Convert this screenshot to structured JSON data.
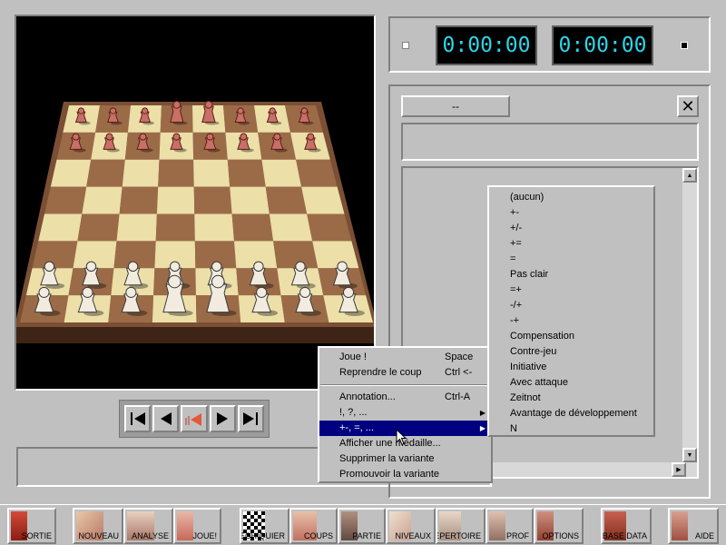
{
  "clocks": {
    "white_time": "0:00:00",
    "black_time": "0:00:00"
  },
  "analysis": {
    "variation_tab": "--",
    "close_glyph": "✕"
  },
  "context_menu": {
    "items": [
      {
        "label": "Joue !",
        "shortcut": "Space"
      },
      {
        "label": "Reprendre le coup",
        "shortcut": "Ctrl <-"
      },
      {
        "label": "Annotation...",
        "shortcut": "Ctrl-A"
      },
      {
        "label": "!, ?, ...",
        "submenu": true
      },
      {
        "label": "+-, =, ...",
        "submenu": true,
        "selected": true
      },
      {
        "label": "Afficher une médaille..."
      },
      {
        "label": "Supprimer la variante"
      },
      {
        "label": "Promouvoir la variante"
      }
    ]
  },
  "submenu": {
    "items": [
      "(aucun)",
      "+-",
      "+/-",
      "+=",
      "=",
      "Pas clair",
      "=+",
      "-/+",
      "-+",
      "Compensation",
      "Contre-jeu",
      "Initiative",
      "Avec attaque",
      "Zeitnot",
      "Avantage de développement",
      "N"
    ]
  },
  "toolbar": {
    "buttons": [
      {
        "label": "SORTIE",
        "icon": "door-icon"
      },
      {
        "label": "NOUVEAU",
        "icon": "hand-icon"
      },
      {
        "label": "ANALYSE",
        "icon": "eye-icon"
      },
      {
        "label": "JOUE!",
        "icon": "person-icon"
      },
      {
        "label": "ECHIQUIER",
        "icon": "chessboard-icon"
      },
      {
        "label": "COUPS",
        "icon": "hands-icon"
      },
      {
        "label": "PARTIE",
        "icon": "king-icon"
      },
      {
        "label": "NIVEAUX",
        "icon": "stairs-icon"
      },
      {
        "label": "REPERTOIRE",
        "icon": "book-icon"
      },
      {
        "label": "PROF",
        "icon": "teacher-icon"
      },
      {
        "label": "OPTIONS",
        "icon": "tools-icon"
      },
      {
        "label": "BASE DATA",
        "icon": "books-icon"
      },
      {
        "label": "AIDE",
        "icon": "help-icon"
      }
    ]
  },
  "colors": {
    "chrome": "#c0c0c0",
    "clock_digits": "#28d8e8",
    "menu_highlight": "#000080",
    "board_light": "#ecdfa8",
    "board_dark": "#9b6b48",
    "board_frame": "#7a4f34"
  }
}
